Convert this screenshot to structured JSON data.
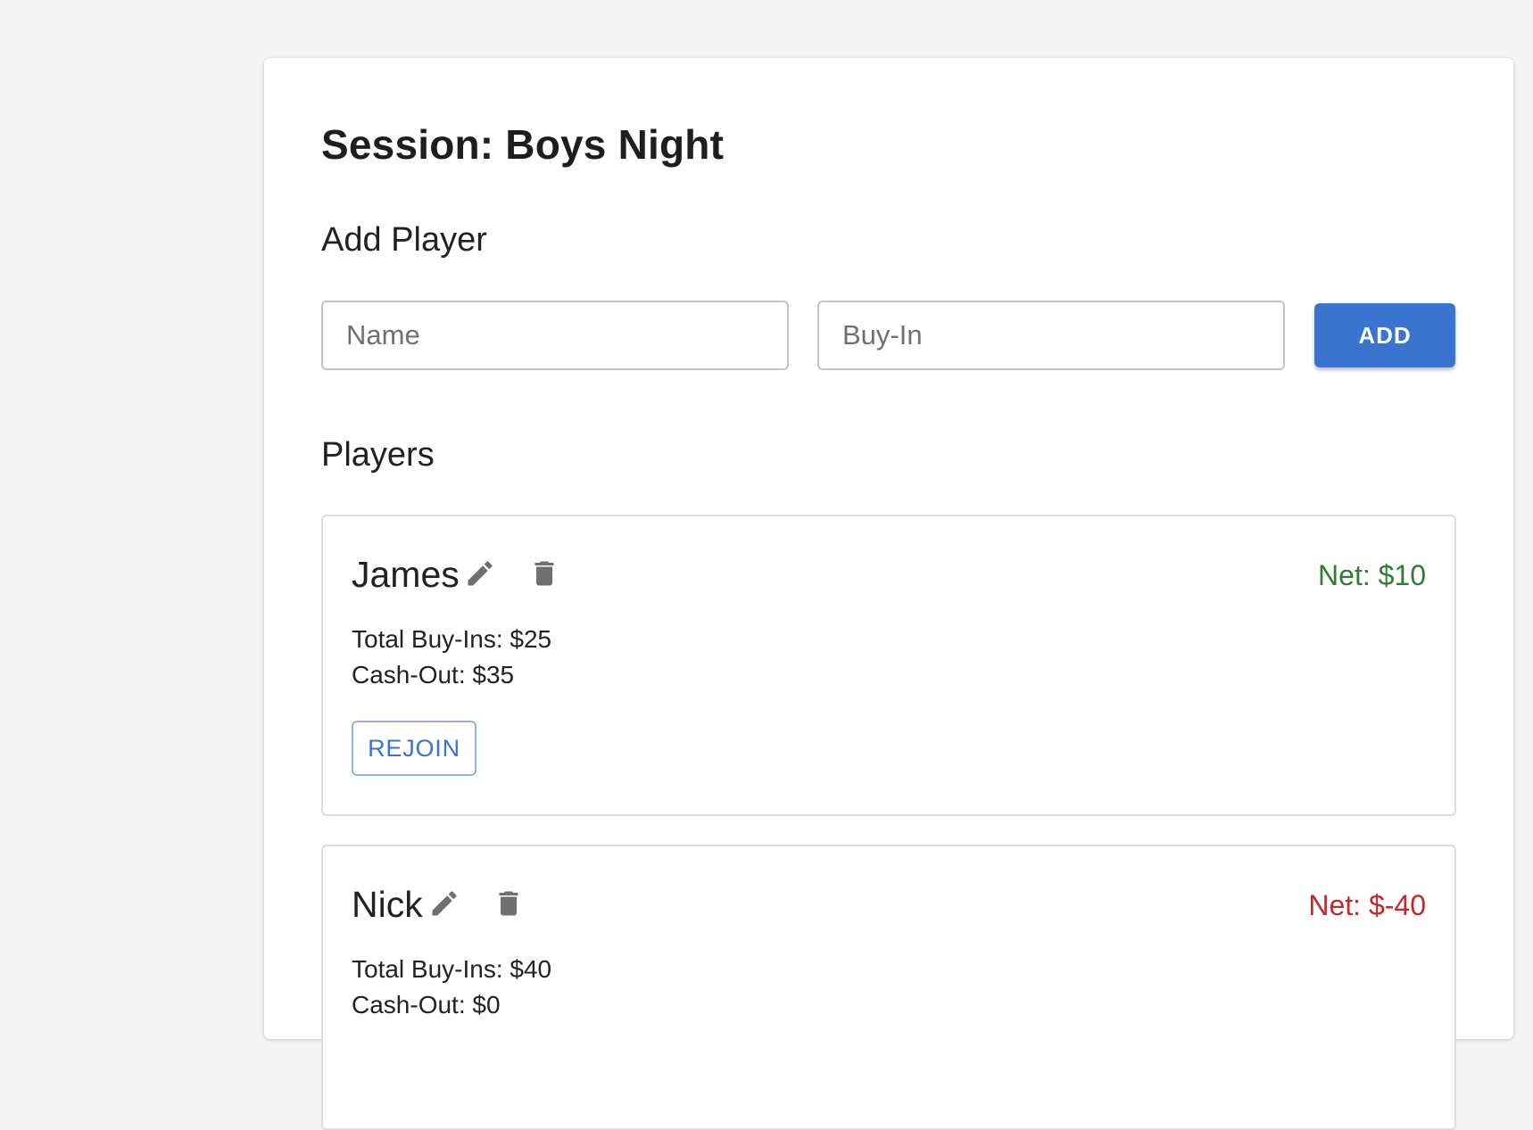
{
  "session": {
    "title": "Session: Boys Night"
  },
  "add_player": {
    "heading": "Add Player",
    "name_placeholder": "Name",
    "buyin_placeholder": "Buy-In",
    "add_label": "ADD"
  },
  "players_section": {
    "heading": "Players"
  },
  "players": [
    {
      "name": "James",
      "net": "Net: $10",
      "net_status": "positive",
      "total_buyins": "Total Buy-Ins: $25",
      "cash_out": "Cash-Out: $35",
      "rejoin_label": "REJOIN"
    },
    {
      "name": "Nick",
      "net": "Net: $-40",
      "net_status": "negative",
      "total_buyins": "Total Buy-Ins: $40",
      "cash_out": "Cash-Out: $0"
    }
  ],
  "icons": {
    "edit": "pencil-icon",
    "delete": "trash-icon"
  },
  "colors": {
    "accent": "#3a74cf",
    "net_positive": "#2e7d32",
    "net_negative": "#c62828",
    "background": "#f4f4f4"
  }
}
